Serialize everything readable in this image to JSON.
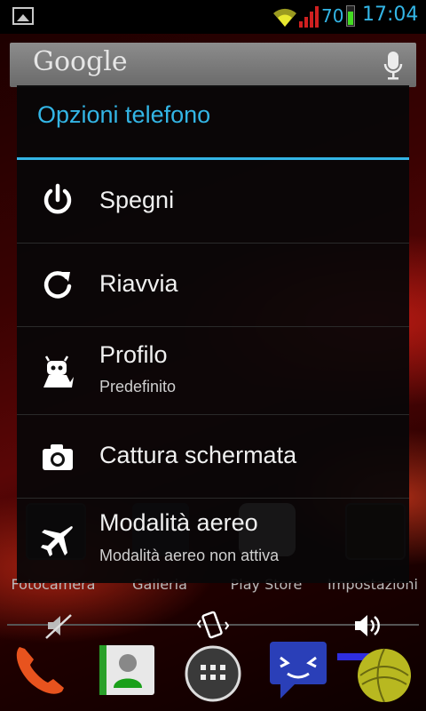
{
  "status_bar": {
    "battery_percent": "70",
    "clock": "17:04",
    "icons": [
      "gallery-icon",
      "wifi-icon",
      "signal-icon",
      "battery-icon"
    ]
  },
  "search": {
    "logo": "Google",
    "icon": "mic-icon"
  },
  "home_apps": [
    {
      "label": "Fotocamera",
      "icon": "camera-app-icon"
    },
    {
      "label": "Galleria",
      "icon": "gallery-app-icon"
    },
    {
      "label": "Play Store",
      "icon": "play-store-icon"
    },
    {
      "label": "Impostazioni",
      "icon": "settings-app-icon"
    }
  ],
  "dialog": {
    "title": "Opzioni telefono",
    "items": [
      {
        "label": "Spegni",
        "icon": "power-icon"
      },
      {
        "label": "Riavvia",
        "icon": "reboot-icon"
      },
      {
        "label": "Profilo",
        "sublabel": "Predefinito",
        "icon": "profile-icon"
      },
      {
        "label": "Cattura schermata",
        "icon": "screenshot-camera-icon"
      },
      {
        "label": "Modalità aereo",
        "sublabel": "Modalità aereo non attiva",
        "icon": "airplane-icon"
      }
    ]
  },
  "sound_modes": [
    "silent-icon",
    "vibrate-icon",
    "sound-on-icon"
  ],
  "dock": [
    "phone-icon",
    "contacts-icon",
    "app-drawer-icon",
    "messaging-icon",
    "browser-icon"
  ],
  "colors": {
    "accent": "#33b5e5",
    "battery": "#44dd22"
  }
}
